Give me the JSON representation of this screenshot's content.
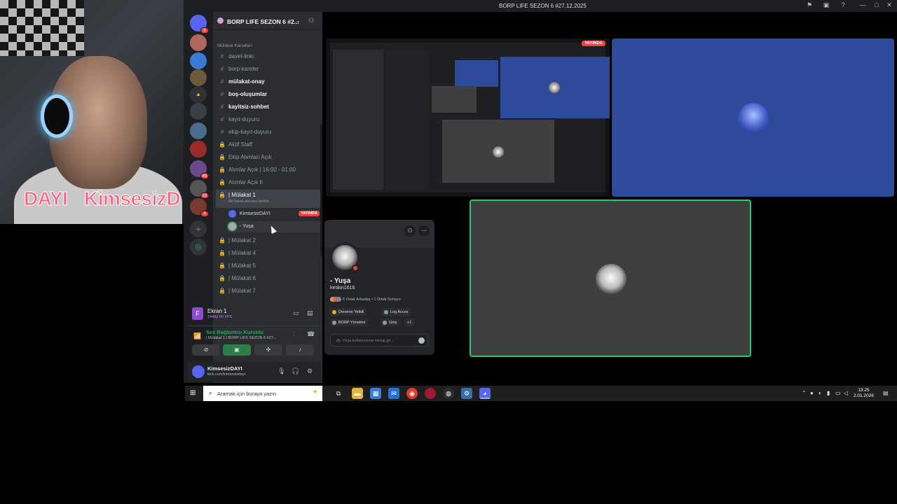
{
  "window": {
    "title": "BORP LIFE SEZON 6 #27.12.2025"
  },
  "webcam": {
    "overlay_left": "DAYI",
    "overlay_right": "KimsesizD"
  },
  "rail": {
    "badges": [
      "6",
      "49",
      "18",
      "4",
      "1"
    ]
  },
  "server": {
    "name": "BORP LIFE SEZON 6 #2..."
  },
  "category": "Mülakat Kanalları",
  "channels": [
    {
      "glyph": "#",
      "label": "davet-linki"
    },
    {
      "glyph": "#",
      "label": "borp-kareler"
    },
    {
      "glyph": "#",
      "label": "mülakat-onay",
      "bold": true
    },
    {
      "glyph": "#",
      "label": "boş-oluşumlar",
      "bold": true
    },
    {
      "glyph": "#",
      "label": "kayitsiz-sohbet",
      "bold": true
    },
    {
      "glyph": "#",
      "label": "kayıt-duyuru"
    },
    {
      "glyph": "#",
      "label": "ekip-kayıt-duyuru"
    },
    {
      "glyph": "lock",
      "label": "Aktif Staff"
    },
    {
      "glyph": "lock",
      "label": "Ekip Alımları Açık"
    },
    {
      "glyph": "lock",
      "label": "Alımlar Açık | 16:00 - 01:00"
    },
    {
      "glyph": "lock",
      "label": "Alımlar Açık II"
    }
  ],
  "selected_channel": {
    "label": "| Mülakat 1",
    "status": "Bir kanal durumu belirle"
  },
  "voice_users": [
    {
      "name": "KimsesizDAYI",
      "badge": "YAYINDA"
    },
    {
      "name": "- Yuşa"
    }
  ],
  "more_channels": [
    "| Mülakat 2",
    "| Mülakat 4",
    "| Mülakat 5",
    "| Mülakat 6",
    "| Mülakat 7"
  ],
  "share": {
    "title": "Ekran 1",
    "quality": "1440p 60 FPS"
  },
  "voice": {
    "status": "Ses Bağlantısı Kuruldu",
    "location": "| Mülakat 1 / BORP LIFE SEZON 6 #27..."
  },
  "user": {
    "name": "KimsesizDAYI",
    "status": "kick.com/kimsesizdayi"
  },
  "stream": {
    "live_badge": "YAYINDA"
  },
  "profile": {
    "display_name": "- Yuşa",
    "username": "keskin1616",
    "mutuals": "6 Ortak Arkadaş • 1 Ortak Sunucu",
    "roles": [
      {
        "name": "Deneme Yetkili",
        "color": "#f0a33a"
      },
      {
        "name": "Log Acces",
        "color": "#949ba4"
      },
      {
        "name": "BORP Yönetimi",
        "color": "#949ba4"
      },
      {
        "name": "Giriş",
        "color": "#949ba4"
      }
    ],
    "more_roles": "+1",
    "message_placeholder": "@- Yuşa kullanıcısına mesaj gö..."
  },
  "taskbar": {
    "search_placeholder": "Aramak için buraya yazın",
    "time": "13:25",
    "date": "2.01.2026"
  },
  "colors": {
    "accent_green": "#23a55a",
    "live_red": "#f23f43",
    "blurple": "#5865f2"
  }
}
